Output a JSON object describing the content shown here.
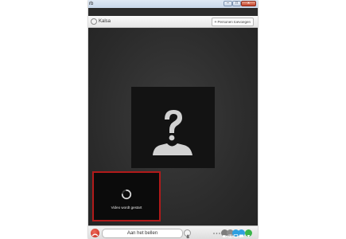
{
  "window": {
    "title": "rb",
    "minimize_label": "–",
    "maximize_label": "□",
    "close_label": "x"
  },
  "call_header": {
    "contact_name": "Kalsa",
    "add_people_label": "Personen toevoegen",
    "add_people_icon": "plus-icon"
  },
  "stage": {
    "remote_placeholder_icon": "unknown-person-icon",
    "self_preview_status": "Video wordt gestart",
    "self_preview_border_color": "#b11a1a"
  },
  "call_bar": {
    "status_text": "Aan het bellen",
    "hangup_color": "#c2281a",
    "icons": [
      "hangup-icon",
      "microphone-icon",
      "volume-icon",
      "camera-icon",
      "dialpad-icon",
      "screen-share-icon",
      "chat-icon",
      "menu-icon"
    ]
  }
}
